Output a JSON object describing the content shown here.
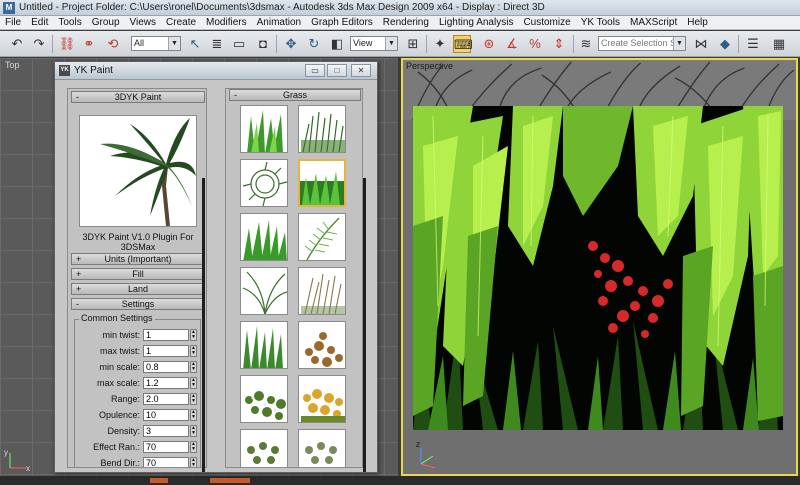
{
  "window": {
    "title": "Untitled     - Project Folder: C:\\Users\\ronel\\Documents\\3dsmax     - Autodesk 3ds Max Design 2009 x64     - Display : Direct 3D"
  },
  "menu": [
    "File",
    "Edit",
    "Tools",
    "Group",
    "Views",
    "Create",
    "Modifiers",
    "Animation",
    "Graph Editors",
    "Rendering",
    "Lighting Analysis",
    "Customize",
    "YK Tools",
    "MAXScript",
    "Help"
  ],
  "toolbar": {
    "filter_value": "All",
    "ref_coord_value": "View",
    "selection_set_placeholder": "Create Selection Se",
    "icons": {
      "undo": "↶",
      "redo": "↷",
      "link": "⛓",
      "unlink": "⚭",
      "bind": "⟲",
      "select": "↖",
      "select_name": "≣",
      "rect_region": "▭",
      "window_crossing": "◘",
      "move": "✥",
      "rotate": "↻",
      "scale": "◧",
      "pivot": "⊞",
      "select_manip": "✦",
      "keyboard": "⌨",
      "snap": "⊛",
      "angle_snap": "∡",
      "percent_snap": "%",
      "spinner_snap": "⇕",
      "edit_named": "≋",
      "mirror": "⋈",
      "align": "◆",
      "layers": "☰",
      "graphite": "▦"
    }
  },
  "viewports": {
    "top_label": "Top",
    "perspective_label": "Perspective",
    "axis_x": "x",
    "axis_y": "y",
    "axis_z": "z"
  },
  "yk_window": {
    "title": "YK Paint",
    "icon_text": "YK",
    "buttons": {
      "minimize": "▭",
      "maximize": "□",
      "close": "✕"
    },
    "left_panel": {
      "header": "3DYK Paint",
      "version_text": "3DYK Paint V1.0 Plugin For 3DSMax",
      "rollouts": [
        {
          "sign": "+",
          "label": "Units (Important)"
        },
        {
          "sign": "+",
          "label": "Fill"
        },
        {
          "sign": "+",
          "label": "Land"
        },
        {
          "sign": "-",
          "label": "Settings"
        }
      ],
      "group_title": "Common Settings",
      "fields": [
        {
          "label": "min twist:",
          "value": "1"
        },
        {
          "label": "max twist:",
          "value": "1"
        },
        {
          "label": "min scale:",
          "value": "0.8"
        },
        {
          "label": "max scale:",
          "value": "1.2"
        },
        {
          "label": "Range:",
          "value": "2.0"
        },
        {
          "label": "Opulence:",
          "value": "10"
        },
        {
          "label": "Density:",
          "value": "3"
        },
        {
          "label": "Effect Ran.:",
          "value": "70"
        },
        {
          "label": "Bend Dir.:",
          "value": "70"
        }
      ],
      "header_sign": "-"
    },
    "right_panel": {
      "header": "Grass",
      "header_sign": "-"
    }
  }
}
